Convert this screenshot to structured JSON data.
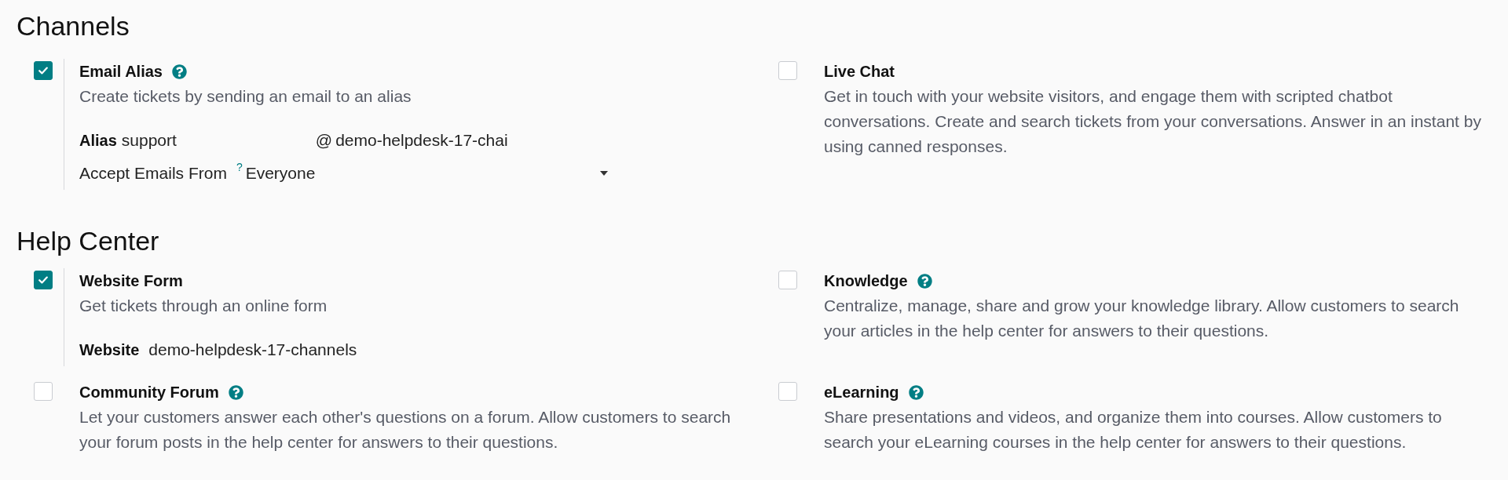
{
  "sections": [
    {
      "title": "Channels",
      "settings": [
        {
          "title": "Email Alias",
          "help": true,
          "checked": true,
          "description": "Create tickets by sending an email to an alias",
          "fields": [
            {
              "kind": "alias",
              "label": "Alias",
              "value": "support",
              "at": "@",
              "domain": "demo-helpdesk-17-chai"
            },
            {
              "kind": "select",
              "label": "Accept Emails From",
              "hint": "?",
              "value": "Everyone"
            }
          ]
        },
        {
          "title": "Live Chat",
          "help": false,
          "checked": false,
          "description": "Get in touch with your website visitors, and engage them with scripted chatbot conversations. Create and search tickets from your conversations. Answer in an instant by using canned responses."
        }
      ]
    },
    {
      "title": "Help Center",
      "settings": [
        {
          "title": "Website Form",
          "help": false,
          "checked": true,
          "description": "Get tickets through an online form",
          "fields": [
            {
              "kind": "text",
              "label": "Website",
              "value": "demo-helpdesk-17-channels"
            }
          ]
        },
        {
          "title": "Knowledge",
          "help": true,
          "checked": false,
          "description": "Centralize, manage, share and grow your knowledge library. Allow customers to search your articles in the help center for answers to their questions."
        },
        {
          "title": "Community Forum",
          "help": true,
          "checked": false,
          "description": "Let your customers answer each other's questions on a forum. Allow customers to search your forum posts in the help center for answers to their questions."
        },
        {
          "title": "eLearning",
          "help": true,
          "checked": false,
          "description": "Share presentations and videos, and organize them into courses. Allow customers to search your eLearning courses in the help center for answers to their questions."
        }
      ]
    }
  ]
}
